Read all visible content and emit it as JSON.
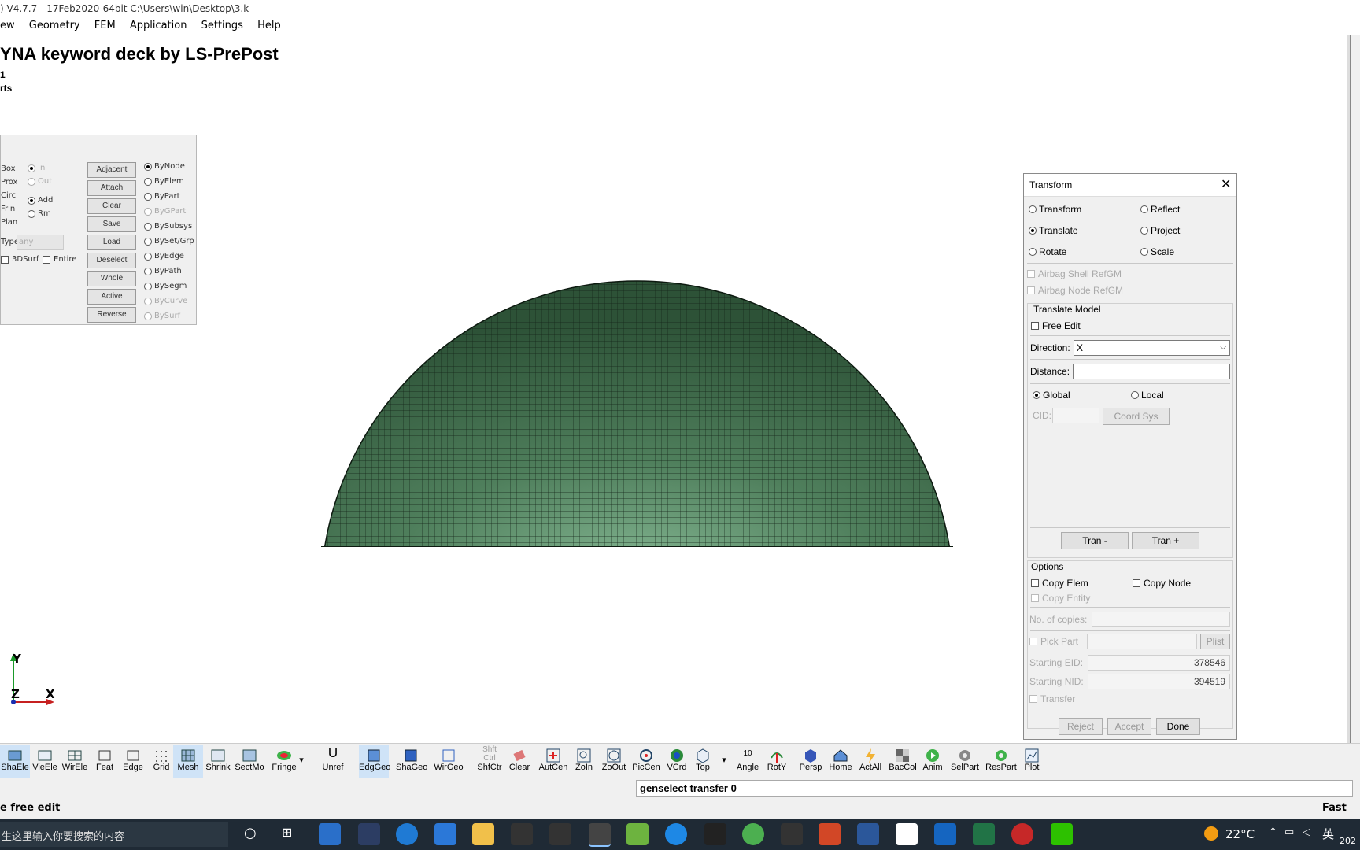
{
  "window": {
    "title": ") V4.7.7 - 17Feb2020-64bit C:\\Users\\win\\Desktop\\3.k"
  },
  "menu": [
    "ew",
    "Geometry",
    "FEM",
    "Application",
    "Settings",
    "Help"
  ],
  "viewport": {
    "deck_title": "YNA keyword deck by LS-PrePost",
    "line1": "1",
    "line2": "rts",
    "axis_y": "Y",
    "axis_z": "Z",
    "axis_x": "X"
  },
  "select_panel": {
    "left_labels": [
      "Box",
      "Prox",
      "Circ",
      "Frin",
      "Plan"
    ],
    "in": "In",
    "out": "Out",
    "add": "Add",
    "rm": "Rm",
    "type_label": "Type",
    "type_value": "any",
    "surf3d": "3DSurf",
    "entire": "Entire",
    "buttons": [
      "Adjacent",
      "Attach",
      "Clear",
      "Save",
      "Load",
      "Deselect",
      "Whole",
      "Active",
      "Reverse"
    ],
    "by_options": [
      "ByNode",
      "ByElem",
      "ByPart",
      "ByGPart",
      "BySubsys",
      "BySet/Grp",
      "ByEdge",
      "ByPath",
      "BySegm",
      "ByCurve",
      "BySurf"
    ]
  },
  "transform": {
    "title": "Transform",
    "modes": [
      "Transform",
      "Reflect",
      "Translate",
      "Project",
      "Rotate",
      "Scale"
    ],
    "airbag_shell": "Airbag Shell RefGM",
    "airbag_node": "Airbag Node RefGM",
    "group_title": "Translate Model",
    "free_edit": "Free Edit",
    "direction_label": "Direction:",
    "direction_value": "X",
    "distance_label": "Distance:",
    "distance_value": "",
    "global": "Global",
    "local": "Local",
    "cid_label": "CID:",
    "coord_sys": "Coord Sys",
    "tran_minus": "Tran -",
    "tran_plus": "Tran +",
    "options_title": "Options",
    "copy_elem": "Copy Elem",
    "copy_node": "Copy Node",
    "copy_entity": "Copy Entity",
    "copies_label": "No. of copies:",
    "pick_part": "Pick Part",
    "plist": "Plist",
    "starting_eid_label": "Starting EID:",
    "starting_eid": "378546",
    "starting_nid_label": "Starting NID:",
    "starting_nid": "394519",
    "transfer": "Transfer",
    "reject": "Reject",
    "accept": "Accept",
    "done": "Done"
  },
  "toolbar": [
    "ShaEle",
    "VieEle",
    "WirEle",
    "Feat",
    "Edge",
    "Grid",
    "Mesh",
    "Shrink",
    "SectMo",
    "Fringe",
    "Unref",
    "EdgGeo",
    "ShaGeo",
    "WirGeo",
    "ShfCtr",
    "Clear",
    "AutCen",
    "ZoIn",
    "ZoOut",
    "PicCen",
    "VCrd",
    "Top",
    "Angle",
    "RotY",
    "Persp",
    "Home",
    "ActAll",
    "BacCol",
    "Anim",
    "SelPart",
    "ResPart",
    "Plot"
  ],
  "toolbar_extra": {
    "shft": "Shft",
    "ctrl": "Ctrl",
    "angle_value": "10",
    "unref_symbol": "U"
  },
  "command": "genselect transfer 0",
  "status": "e free edit",
  "status_right": "Fast Ren",
  "taskbar": {
    "search": "生这里输入你要搜索的内容",
    "temperature": "22°C",
    "lang": "英",
    "year": "202"
  },
  "colors": {
    "mesh_green": "#3e6e4a",
    "mesh_light": "#7fb08b",
    "accent": "#0078d7"
  }
}
